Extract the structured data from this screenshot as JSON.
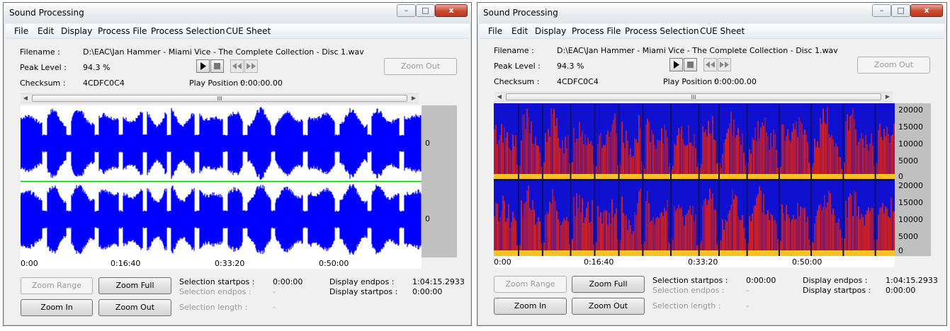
{
  "windows": [
    {
      "id": "waveform",
      "title": "Sound Processing",
      "titlebar_buttons": {
        "minimize": "–",
        "maximize": "□",
        "close": "x"
      },
      "menu": [
        "File",
        "Edit",
        "Display",
        "Process File",
        "Process Selection",
        "CUE Sheet"
      ],
      "info": {
        "filename_label": "Filename :",
        "filename_value": "D:\\EAC\\Jan Hammer - Miami Vice - The Complete Collection - Disc 1.wav",
        "peak_label": "Peak Level :",
        "peak_value": "94.3 %",
        "checksum_label": "Checksum :",
        "checksum_value": "4CDFC0C4",
        "play_position_label": "Play Position :",
        "play_position_value": "0:00:00.00",
        "zoom_out_top": "Zoom Out"
      },
      "scroll_thumb": "III",
      "channel_labels": [
        "0",
        "0"
      ],
      "time_ticks": [
        "0:00",
        "0:16:40",
        "0:33:20",
        "0:50:00"
      ],
      "buttons": {
        "zoom_range": "Zoom Range",
        "zoom_full": "Zoom Full",
        "zoom_in": "Zoom In",
        "zoom_out": "Zoom Out"
      },
      "selection": {
        "startpos_label": "Selection startpos :",
        "startpos_value": "0:00:00",
        "endpos_label": "Selection endpos :",
        "endpos_value": "-",
        "length_label": "Selection length :",
        "length_value": "-"
      },
      "display": {
        "endpos_label": "Display endpos :",
        "endpos_value": "1:04:15.2933",
        "startpos_label": "Display startpos :",
        "startpos_value": "0:00:00"
      },
      "colors": {
        "waveform": "#0000ff",
        "center_line": "#00c000",
        "axis_strip": "#c0c0c0"
      }
    },
    {
      "id": "spectrogram",
      "title": "Sound Processing",
      "titlebar_buttons": {
        "minimize": "–",
        "maximize": "□",
        "close": "x"
      },
      "menu": [
        "File",
        "Edit",
        "Display",
        "Process File",
        "Process Selection",
        "CUE Sheet"
      ],
      "info": {
        "filename_label": "Filename :",
        "filename_value": "D:\\EAC\\Jan Hammer - Miami Vice - The Complete Collection - Disc 1.wav",
        "peak_label": "Peak Level :",
        "peak_value": "94.3 %",
        "checksum_label": "Checksum :",
        "checksum_value": "4CDFC0C4",
        "play_position_label": "Play Position :",
        "play_position_value": "0:00:00.00",
        "zoom_out_top": "Zoom Out"
      },
      "scroll_thumb": "III",
      "frequency_labels": [
        "20000",
        "15000",
        "10000",
        "5000",
        "0"
      ],
      "time_ticks": [
        "0:00",
        "0:16:40",
        "0:33:20",
        "0:50:00"
      ],
      "buttons": {
        "zoom_range": "Zoom Range",
        "zoom_full": "Zoom Full",
        "zoom_in": "Zoom In",
        "zoom_out": "Zoom Out"
      },
      "selection": {
        "startpos_label": "Selection startpos :",
        "startpos_value": "0:00:00",
        "endpos_label": "Selection endpos :",
        "endpos_value": "-",
        "length_label": "Selection length :",
        "length_value": "-"
      },
      "display": {
        "endpos_label": "Display endpos :",
        "endpos_value": "1:04:15.2933",
        "startpos_label": "Display startpos :",
        "startpos_value": "0:00:00"
      },
      "colors": {
        "background": "#1010d0",
        "hot": "#e02010",
        "peak": "#ffe020",
        "axis_strip": "#c0c0c0"
      }
    }
  ]
}
